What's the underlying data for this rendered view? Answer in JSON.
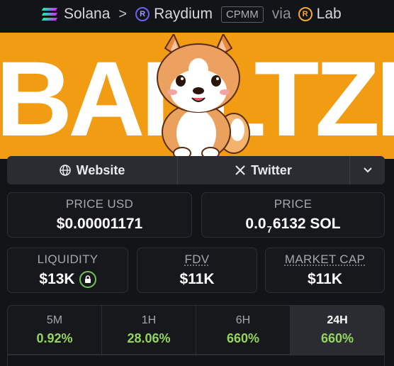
{
  "breadcrumb": {
    "chain": "Solana",
    "dex": "Raydium",
    "pool_type": "CPMM",
    "via": "via",
    "launchpad": "Lab"
  },
  "banner": {
    "text": "BALLTZE"
  },
  "links": {
    "website": "Website",
    "twitter": "Twitter"
  },
  "stats": {
    "price_usd_label": "PRICE USD",
    "price_usd_value": "$0.00001171",
    "price_label": "PRICE",
    "price_value_prefix": "0.0",
    "price_value_sub": "7",
    "price_value_suffix": "6132 SOL",
    "liquidity_label": "LIQUIDITY",
    "liquidity_value": "$13K",
    "fdv_label": "FDV",
    "fdv_value": "$11K",
    "mcap_label": "MARKET CAP",
    "mcap_value": "$11K"
  },
  "timeframes": [
    {
      "period": "5M",
      "change": "0.92%"
    },
    {
      "period": "1H",
      "change": "28.06%"
    },
    {
      "period": "6H",
      "change": "660%"
    },
    {
      "period": "24H",
      "change": "660%"
    }
  ],
  "colors": {
    "accent_green": "#95d55f",
    "banner_orange": "#f29c14",
    "background": "#131417"
  }
}
